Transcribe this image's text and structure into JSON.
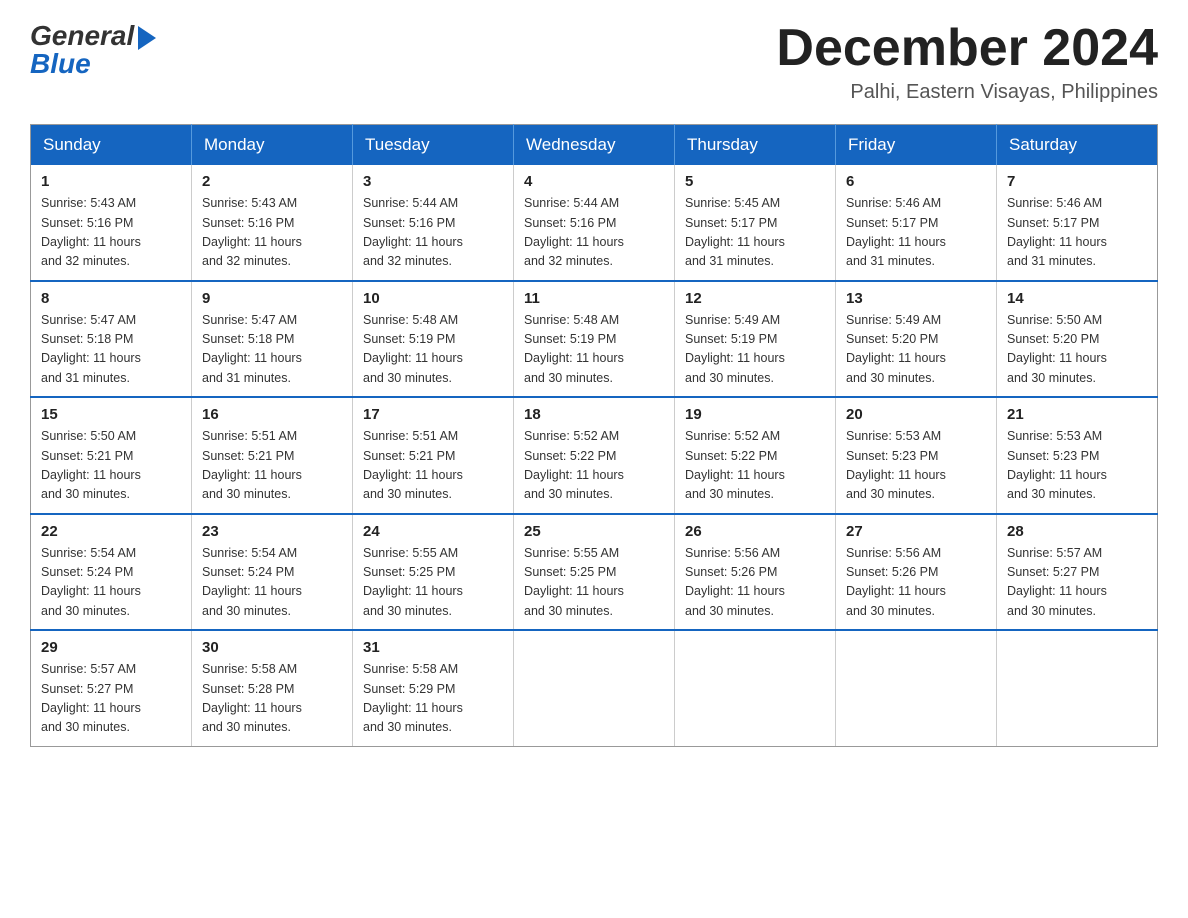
{
  "header": {
    "logo_general": "General",
    "logo_blue": "Blue",
    "month_title": "December 2024",
    "location": "Palhi, Eastern Visayas, Philippines"
  },
  "days_of_week": [
    "Sunday",
    "Monday",
    "Tuesday",
    "Wednesday",
    "Thursday",
    "Friday",
    "Saturday"
  ],
  "weeks": [
    [
      {
        "day": "1",
        "sunrise": "5:43 AM",
        "sunset": "5:16 PM",
        "daylight": "11 hours and 32 minutes."
      },
      {
        "day": "2",
        "sunrise": "5:43 AM",
        "sunset": "5:16 PM",
        "daylight": "11 hours and 32 minutes."
      },
      {
        "day": "3",
        "sunrise": "5:44 AM",
        "sunset": "5:16 PM",
        "daylight": "11 hours and 32 minutes."
      },
      {
        "day": "4",
        "sunrise": "5:44 AM",
        "sunset": "5:16 PM",
        "daylight": "11 hours and 32 minutes."
      },
      {
        "day": "5",
        "sunrise": "5:45 AM",
        "sunset": "5:17 PM",
        "daylight": "11 hours and 31 minutes."
      },
      {
        "day": "6",
        "sunrise": "5:46 AM",
        "sunset": "5:17 PM",
        "daylight": "11 hours and 31 minutes."
      },
      {
        "day": "7",
        "sunrise": "5:46 AM",
        "sunset": "5:17 PM",
        "daylight": "11 hours and 31 minutes."
      }
    ],
    [
      {
        "day": "8",
        "sunrise": "5:47 AM",
        "sunset": "5:18 PM",
        "daylight": "11 hours and 31 minutes."
      },
      {
        "day": "9",
        "sunrise": "5:47 AM",
        "sunset": "5:18 PM",
        "daylight": "11 hours and 31 minutes."
      },
      {
        "day": "10",
        "sunrise": "5:48 AM",
        "sunset": "5:19 PM",
        "daylight": "11 hours and 30 minutes."
      },
      {
        "day": "11",
        "sunrise": "5:48 AM",
        "sunset": "5:19 PM",
        "daylight": "11 hours and 30 minutes."
      },
      {
        "day": "12",
        "sunrise": "5:49 AM",
        "sunset": "5:19 PM",
        "daylight": "11 hours and 30 minutes."
      },
      {
        "day": "13",
        "sunrise": "5:49 AM",
        "sunset": "5:20 PM",
        "daylight": "11 hours and 30 minutes."
      },
      {
        "day": "14",
        "sunrise": "5:50 AM",
        "sunset": "5:20 PM",
        "daylight": "11 hours and 30 minutes."
      }
    ],
    [
      {
        "day": "15",
        "sunrise": "5:50 AM",
        "sunset": "5:21 PM",
        "daylight": "11 hours and 30 minutes."
      },
      {
        "day": "16",
        "sunrise": "5:51 AM",
        "sunset": "5:21 PM",
        "daylight": "11 hours and 30 minutes."
      },
      {
        "day": "17",
        "sunrise": "5:51 AM",
        "sunset": "5:21 PM",
        "daylight": "11 hours and 30 minutes."
      },
      {
        "day": "18",
        "sunrise": "5:52 AM",
        "sunset": "5:22 PM",
        "daylight": "11 hours and 30 minutes."
      },
      {
        "day": "19",
        "sunrise": "5:52 AM",
        "sunset": "5:22 PM",
        "daylight": "11 hours and 30 minutes."
      },
      {
        "day": "20",
        "sunrise": "5:53 AM",
        "sunset": "5:23 PM",
        "daylight": "11 hours and 30 minutes."
      },
      {
        "day": "21",
        "sunrise": "5:53 AM",
        "sunset": "5:23 PM",
        "daylight": "11 hours and 30 minutes."
      }
    ],
    [
      {
        "day": "22",
        "sunrise": "5:54 AM",
        "sunset": "5:24 PM",
        "daylight": "11 hours and 30 minutes."
      },
      {
        "day": "23",
        "sunrise": "5:54 AM",
        "sunset": "5:24 PM",
        "daylight": "11 hours and 30 minutes."
      },
      {
        "day": "24",
        "sunrise": "5:55 AM",
        "sunset": "5:25 PM",
        "daylight": "11 hours and 30 minutes."
      },
      {
        "day": "25",
        "sunrise": "5:55 AM",
        "sunset": "5:25 PM",
        "daylight": "11 hours and 30 minutes."
      },
      {
        "day": "26",
        "sunrise": "5:56 AM",
        "sunset": "5:26 PM",
        "daylight": "11 hours and 30 minutes."
      },
      {
        "day": "27",
        "sunrise": "5:56 AM",
        "sunset": "5:26 PM",
        "daylight": "11 hours and 30 minutes."
      },
      {
        "day": "28",
        "sunrise": "5:57 AM",
        "sunset": "5:27 PM",
        "daylight": "11 hours and 30 minutes."
      }
    ],
    [
      {
        "day": "29",
        "sunrise": "5:57 AM",
        "sunset": "5:27 PM",
        "daylight": "11 hours and 30 minutes."
      },
      {
        "day": "30",
        "sunrise": "5:58 AM",
        "sunset": "5:28 PM",
        "daylight": "11 hours and 30 minutes."
      },
      {
        "day": "31",
        "sunrise": "5:58 AM",
        "sunset": "5:29 PM",
        "daylight": "11 hours and 30 minutes."
      },
      null,
      null,
      null,
      null
    ]
  ],
  "labels": {
    "sunrise": "Sunrise:",
    "sunset": "Sunset:",
    "daylight": "Daylight:"
  }
}
